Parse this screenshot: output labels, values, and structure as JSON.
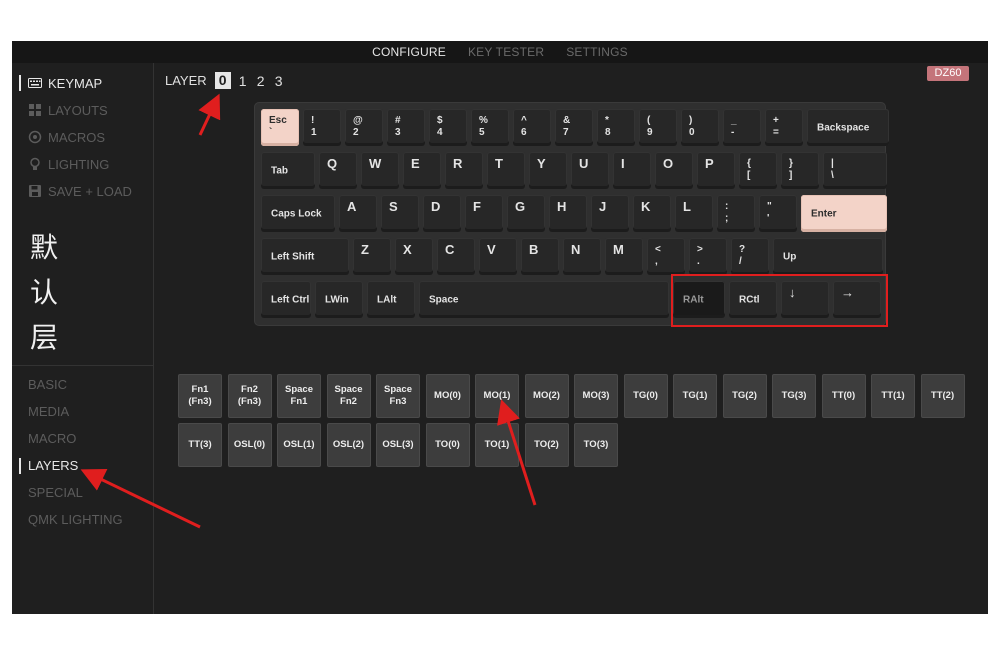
{
  "nav": {
    "tabs": [
      {
        "label": "CONFIGURE"
      },
      {
        "label": "KEY TESTER"
      },
      {
        "label": "SETTINGS"
      }
    ]
  },
  "sidebar": {
    "menu": [
      {
        "label": "KEYMAP",
        "icon": "keyboard-icon"
      },
      {
        "label": "LAYOUTS",
        "icon": "layouts-icon"
      },
      {
        "label": "MACROS",
        "icon": "macros-icon"
      },
      {
        "label": "LIGHTING",
        "icon": "lightbulb-icon"
      },
      {
        "label": "SAVE + LOAD",
        "icon": "save-icon"
      }
    ],
    "annotation": [
      "默",
      "认",
      "层"
    ],
    "categories": [
      {
        "label": "BASIC"
      },
      {
        "label": "MEDIA"
      },
      {
        "label": "MACRO"
      },
      {
        "label": "LAYERS"
      },
      {
        "label": "SPECIAL"
      },
      {
        "label": "QMK LIGHTING"
      }
    ]
  },
  "layer_selector": {
    "label": "LAYER",
    "layers": [
      "0",
      "1",
      "2",
      "3"
    ],
    "active": "0"
  },
  "board_badge": "DZ60",
  "keyboard": {
    "row1": [
      {
        "top": "Esc",
        "bottom": "`"
      },
      {
        "top": "!",
        "bottom": "1"
      },
      {
        "top": "@",
        "bottom": "2"
      },
      {
        "top": "#",
        "bottom": "3"
      },
      {
        "top": "$",
        "bottom": "4"
      },
      {
        "top": "%",
        "bottom": "5"
      },
      {
        "top": "^",
        "bottom": "6"
      },
      {
        "top": "&",
        "bottom": "7"
      },
      {
        "top": "*",
        "bottom": "8"
      },
      {
        "top": "(",
        "bottom": "9"
      },
      {
        "top": ")",
        "bottom": "0"
      },
      {
        "top": "_",
        "bottom": "-"
      },
      {
        "top": "+",
        "bottom": "="
      },
      {
        "top": "Backspace",
        "bottom": ""
      }
    ],
    "row2": [
      {
        "top": "Tab",
        "bottom": ""
      },
      {
        "top": "Q",
        "bottom": ""
      },
      {
        "top": "W",
        "bottom": ""
      },
      {
        "top": "E",
        "bottom": ""
      },
      {
        "top": "R",
        "bottom": ""
      },
      {
        "top": "T",
        "bottom": ""
      },
      {
        "top": "Y",
        "bottom": ""
      },
      {
        "top": "U",
        "bottom": ""
      },
      {
        "top": "I",
        "bottom": ""
      },
      {
        "top": "O",
        "bottom": ""
      },
      {
        "top": "P",
        "bottom": ""
      },
      {
        "top": "{",
        "bottom": "["
      },
      {
        "top": "}",
        "bottom": "]"
      },
      {
        "top": "|",
        "bottom": "\\"
      }
    ],
    "row3": [
      {
        "top": "Caps Lock",
        "bottom": ""
      },
      {
        "top": "A",
        "bottom": ""
      },
      {
        "top": "S",
        "bottom": ""
      },
      {
        "top": "D",
        "bottom": ""
      },
      {
        "top": "F",
        "bottom": ""
      },
      {
        "top": "G",
        "bottom": ""
      },
      {
        "top": "H",
        "bottom": ""
      },
      {
        "top": "J",
        "bottom": ""
      },
      {
        "top": "K",
        "bottom": ""
      },
      {
        "top": "L",
        "bottom": ""
      },
      {
        "top": ":",
        "bottom": ";"
      },
      {
        "top": "\"",
        "bottom": "'"
      },
      {
        "top": "Enter",
        "bottom": ""
      }
    ],
    "row4": [
      {
        "top": "Left Shift",
        "bottom": ""
      },
      {
        "top": "Z",
        "bottom": ""
      },
      {
        "top": "X",
        "bottom": ""
      },
      {
        "top": "C",
        "bottom": ""
      },
      {
        "top": "V",
        "bottom": ""
      },
      {
        "top": "B",
        "bottom": ""
      },
      {
        "top": "N",
        "bottom": ""
      },
      {
        "top": "M",
        "bottom": ""
      },
      {
        "top": "<",
        "bottom": ","
      },
      {
        "top": ">",
        "bottom": "."
      },
      {
        "top": "?",
        "bottom": "/"
      },
      {
        "top": "Up",
        "bottom": ""
      }
    ],
    "row5": [
      {
        "top": "Left Ctrl",
        "bottom": ""
      },
      {
        "top": "LWin",
        "bottom": ""
      },
      {
        "top": "LAlt",
        "bottom": ""
      },
      {
        "top": "Space",
        "bottom": ""
      },
      {
        "top": "RAlt",
        "bottom": ""
      },
      {
        "top": "RCtl",
        "bottom": ""
      },
      {
        "top": "↓",
        "bottom": ""
      },
      {
        "top": "→",
        "bottom": ""
      }
    ]
  },
  "keycodes": [
    "Fn1\n(Fn3)",
    "Fn2\n(Fn3)",
    "Space\nFn1",
    "Space\nFn2",
    "Space\nFn3",
    "MO(0)",
    "MO(1)",
    "MO(2)",
    "MO(3)",
    "TG(0)",
    "TG(1)",
    "TG(2)",
    "TG(3)",
    "TT(0)",
    "TT(1)",
    "TT(2)",
    "TT(3)",
    "OSL(0)",
    "OSL(1)",
    "OSL(2)",
    "OSL(3)",
    "TO(0)",
    "TO(1)",
    "TO(2)",
    "TO(3)"
  ],
  "colors": {
    "accent_key": "#f3d3c8",
    "badge": "#c4747a",
    "highlight": "#e01e1e"
  }
}
